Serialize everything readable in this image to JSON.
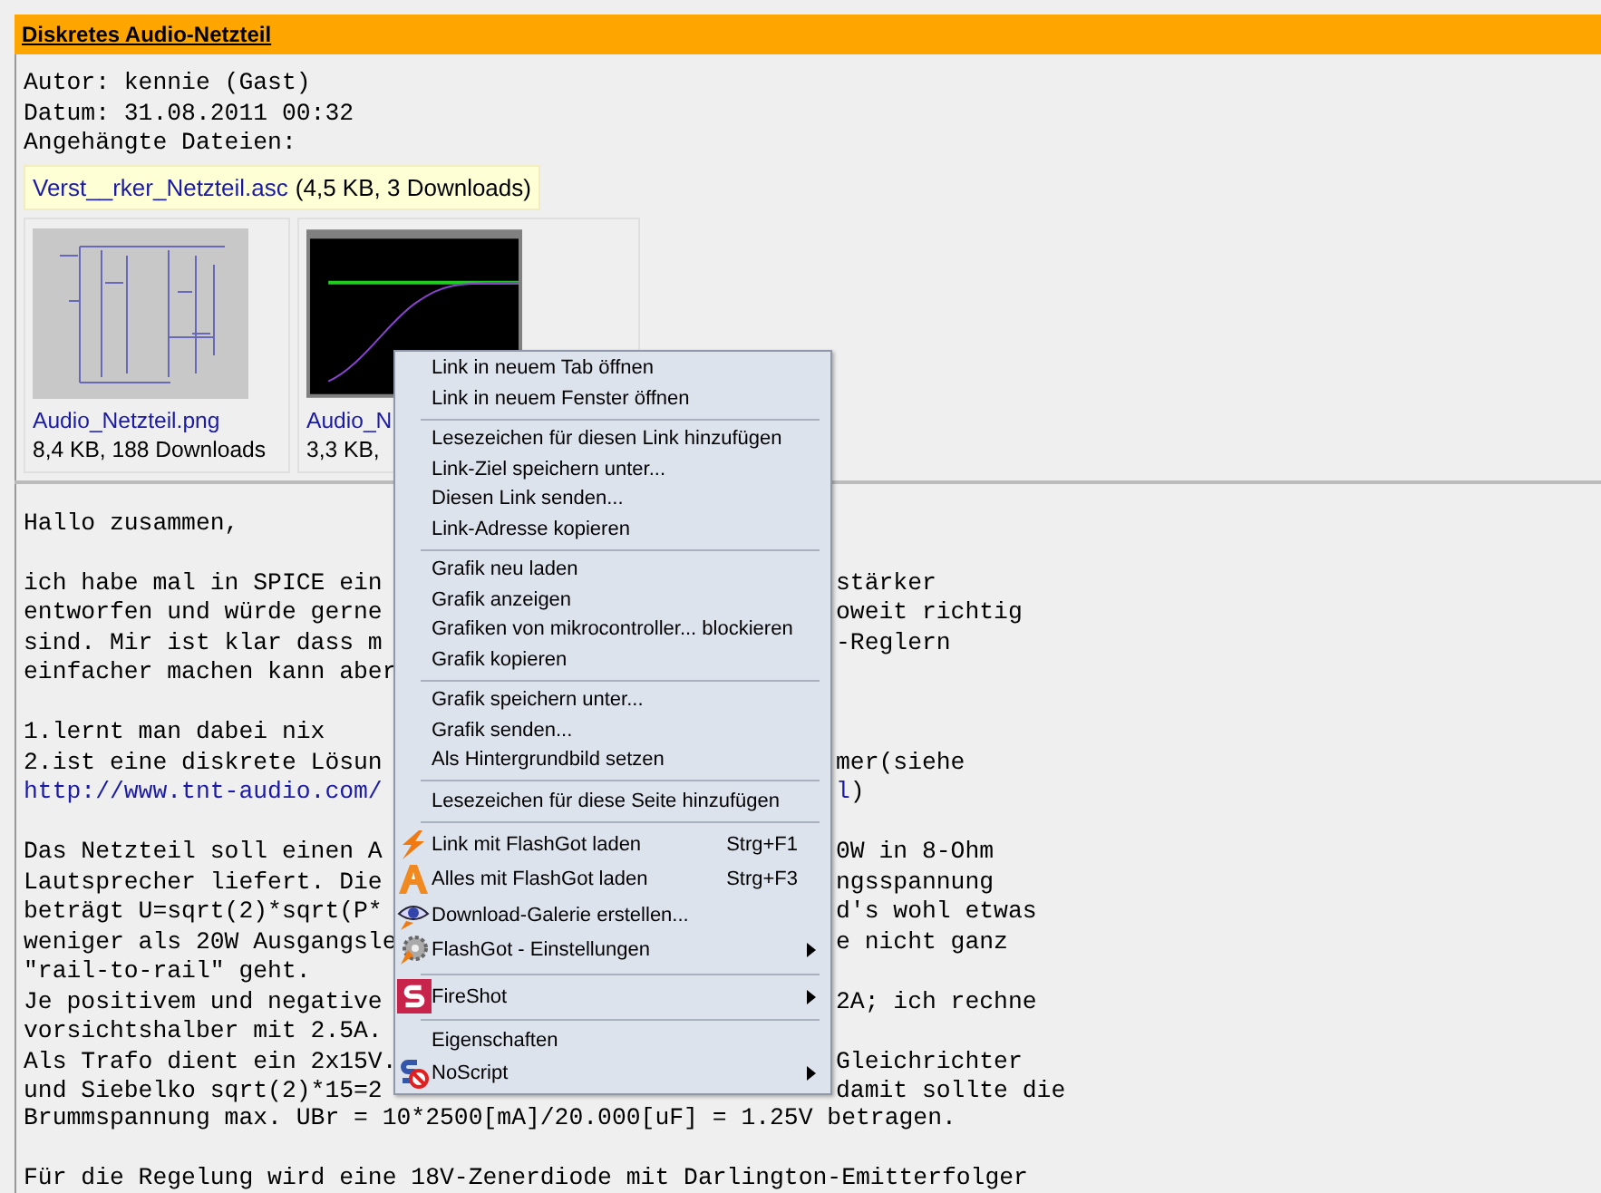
{
  "post": {
    "title": "Diskretes Audio-Netzteil",
    "meta": [
      "Autor: kennie (Gast)",
      "Datum: 31.08.2011 00:32",
      "Angehängte Dateien:"
    ],
    "attachment": {
      "name": "Verst__rker_Netzteil.asc",
      "info": "(4,5 KB, 3 Downloads)"
    },
    "thumbnails": [
      {
        "kind": "schematic",
        "name": "Audio_Netzteil.png",
        "info": "8,4 KB, 188 Downloads"
      },
      {
        "kind": "plot",
        "name": "Audio_N",
        "info": "3,3 KB,"
      }
    ],
    "body": [
      {
        "left": [
          {
            "kind": "text",
            "text": "Hallo zusammen,"
          }
        ]
      },
      {
        "kind": "blank"
      },
      {
        "left": [
          {
            "kind": "text",
            "text": "ich habe mal in SPICE ein"
          }
        ],
        "right": [
          {
            "kind": "text",
            "text": "stärker"
          }
        ]
      },
      {
        "left": [
          {
            "kind": "text",
            "text": "entworfen und würde gerne"
          }
        ],
        "right": [
          {
            "kind": "text",
            "text": "oweit richtig"
          }
        ]
      },
      {
        "left": [
          {
            "kind": "text",
            "text": "sind. Mir ist klar dass m"
          }
        ],
        "right": [
          {
            "kind": "text",
            "text": "-Reglern"
          }
        ]
      },
      {
        "left": [
          {
            "kind": "text",
            "text": "einfacher machen kann aber"
          }
        ]
      },
      {
        "kind": "blank"
      },
      {
        "left": [
          {
            "kind": "text",
            "text": "1.lernt man dabei nix"
          }
        ]
      },
      {
        "left": [
          {
            "kind": "text",
            "text": "2.ist eine diskrete Lösun"
          }
        ],
        "right": [
          {
            "kind": "text",
            "text": "mer(siehe"
          }
        ]
      },
      {
        "left": [
          {
            "kind": "link",
            "text": "http://www.tnt-audio.com/"
          }
        ],
        "right": [
          {
            "kind": "link",
            "text": "l"
          },
          {
            "kind": "text",
            "text": ")"
          }
        ]
      },
      {
        "kind": "blank"
      },
      {
        "left": [
          {
            "kind": "text",
            "text": "Das Netzteil soll einen A"
          }
        ],
        "right": [
          {
            "kind": "text",
            "text": "0W in 8-Ohm"
          }
        ]
      },
      {
        "left": [
          {
            "kind": "text",
            "text": "Lautsprecher liefert. Die"
          }
        ],
        "right": [
          {
            "kind": "text",
            "text": "ngsspannung"
          }
        ]
      },
      {
        "left": [
          {
            "kind": "text",
            "text": "beträgt U=sqrt(2)*sqrt(P*"
          }
        ],
        "right": [
          {
            "kind": "text",
            "text": "d's wohl etwas"
          }
        ]
      },
      {
        "left": [
          {
            "kind": "text",
            "text": "weniger als 20W Ausgangsle"
          }
        ],
        "right": [
          {
            "kind": "text",
            "text": "e nicht ganz"
          }
        ]
      },
      {
        "left": [
          {
            "kind": "text",
            "text": "\"rail-to-rail\" geht."
          }
        ]
      },
      {
        "left": [
          {
            "kind": "text",
            "text": "Je positivem und negative"
          }
        ],
        "right": [
          {
            "kind": "text",
            "text": "2A; ich rechne"
          }
        ]
      },
      {
        "left": [
          {
            "kind": "text",
            "text": "vorsichtshalber mit 2.5A."
          }
        ]
      },
      {
        "left": [
          {
            "kind": "text",
            "text": "Als Trafo dient ein 2x15V."
          }
        ],
        "right": [
          {
            "kind": "text",
            "text": "Gleichrichter"
          }
        ]
      },
      {
        "left": [
          {
            "kind": "text",
            "text": "und Siebelko sqrt(2)*15=2"
          }
        ],
        "right": [
          {
            "kind": "text",
            "text": "damit sollte die"
          }
        ]
      },
      {
        "full": "Brummspannung max. UBr = 10*2500[mA]/20.000[uF] = 1.25V betragen."
      },
      {
        "kind": "blank"
      },
      {
        "full": "Für die Regelung wird eine 18V-Zenerdiode mit Darlington-Emitterfolger"
      }
    ]
  },
  "context_menu": [
    {
      "kind": "item",
      "label": "Link in neuem Tab öffnen"
    },
    {
      "kind": "item",
      "label": "Link in neuem Fenster öffnen"
    },
    {
      "kind": "separator"
    },
    {
      "kind": "item",
      "label": "Lesezeichen für diesen Link hinzufügen"
    },
    {
      "kind": "item",
      "label": "Link-Ziel speichern unter..."
    },
    {
      "kind": "item",
      "label": "Diesen Link senden..."
    },
    {
      "kind": "item",
      "label": "Link-Adresse kopieren"
    },
    {
      "kind": "separator"
    },
    {
      "kind": "item",
      "label": "Grafik neu laden"
    },
    {
      "kind": "item",
      "label": "Grafik anzeigen"
    },
    {
      "kind": "item",
      "label": "Grafiken von mikrocontroller... blockieren"
    },
    {
      "kind": "item",
      "label": "Grafik kopieren"
    },
    {
      "kind": "separator"
    },
    {
      "kind": "item",
      "label": "Grafik speichern unter..."
    },
    {
      "kind": "item",
      "label": "Grafik senden..."
    },
    {
      "kind": "item",
      "label": "Als Hintergrundbild setzen"
    },
    {
      "kind": "separator"
    },
    {
      "kind": "item",
      "label": "Lesezeichen für diese Seite hinzufügen"
    },
    {
      "kind": "separator"
    },
    {
      "kind": "icon_item",
      "label": "Link mit FlashGot laden",
      "shortcut": "Strg+F1"
    },
    {
      "kind": "icon_item",
      "label": "Alles mit FlashGot laden",
      "shortcut": "Strg+F3"
    },
    {
      "kind": "icon_item",
      "label": "Download-Galerie erstellen..."
    },
    {
      "kind": "icon_item",
      "label": "FlashGot - Einstellungen",
      "submenu": true
    },
    {
      "kind": "separator"
    },
    {
      "kind": "icon_item",
      "label": "FireShot",
      "submenu": true
    },
    {
      "kind": "separator"
    },
    {
      "kind": "item",
      "label": "Eigenschaften"
    },
    {
      "kind": "icon_item",
      "label": "NoScript",
      "submenu": true
    }
  ]
}
